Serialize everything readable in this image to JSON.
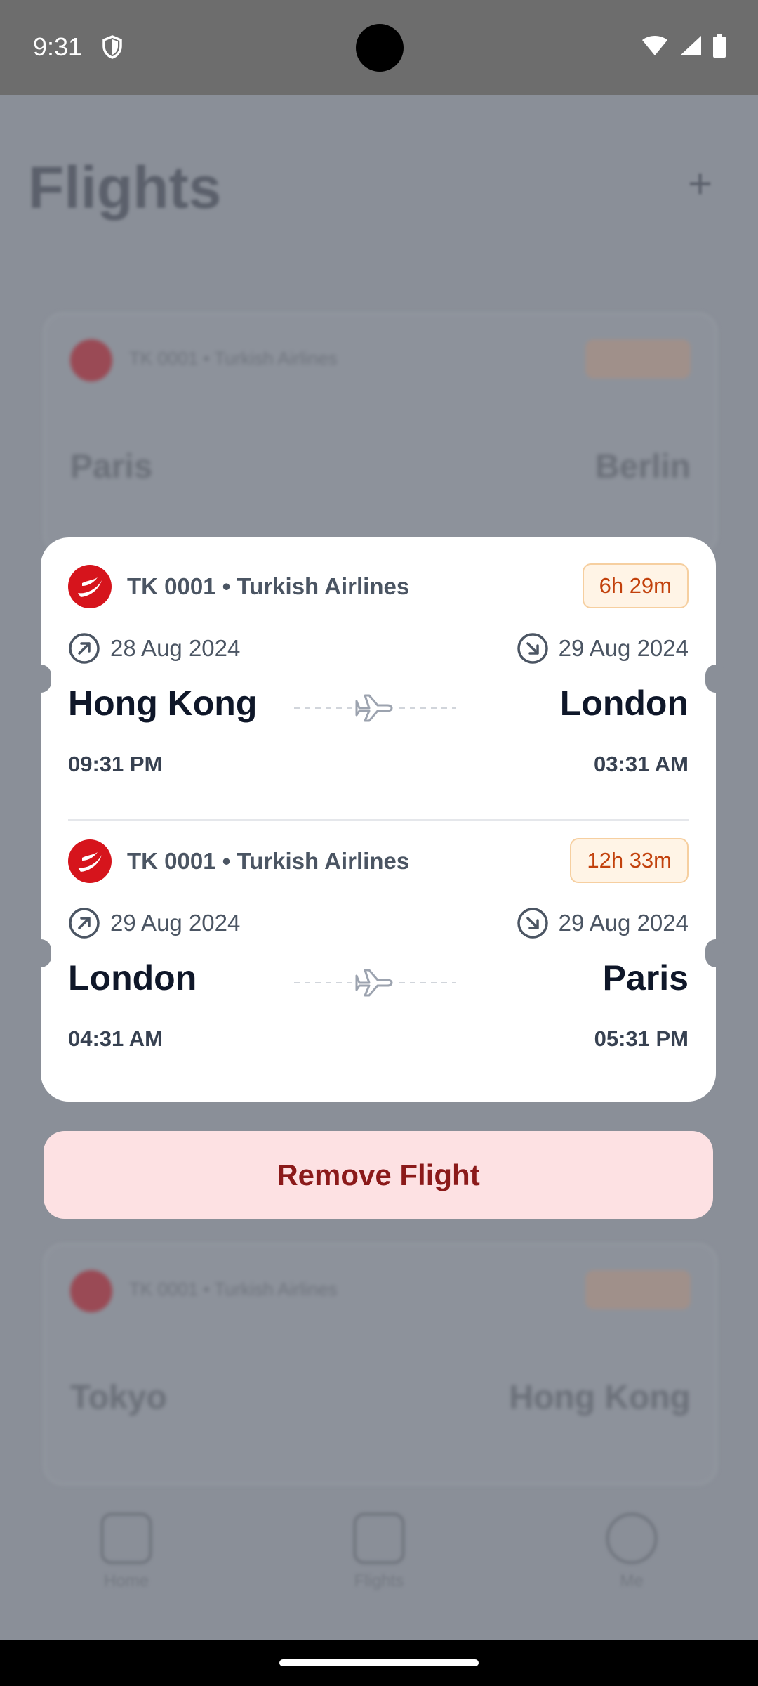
{
  "status_bar": {
    "time": "9:31",
    "icons": [
      "shield-icon",
      "wifi-icon",
      "signal-icon",
      "battery-icon"
    ]
  },
  "background": {
    "title": "Flights",
    "add_icon": "plus-icon",
    "cards": [
      {
        "airline": "TK 0001 • Turkish Airlines",
        "from": "Paris",
        "to": "Berlin"
      },
      {
        "airline": "TK 0001 • Turkish Airlines",
        "from": "Tokyo",
        "to": "Hong Kong"
      }
    ],
    "tabs": [
      "Home",
      "Flights",
      "Me"
    ]
  },
  "modal": {
    "segments": [
      {
        "airline": "TK 0001 • Turkish Airlines",
        "duration": "6h 29m",
        "departure_date": "28 Aug 2024",
        "arrival_date": "29 Aug 2024",
        "from": "Hong Kong",
        "to": "London",
        "departure_time": "09:31 PM",
        "arrival_time": "03:31 AM"
      },
      {
        "airline": "TK 0001 • Turkish Airlines",
        "duration": "12h 33m",
        "departure_date": "29 Aug 2024",
        "arrival_date": "29 Aug 2024",
        "from": "London",
        "to": "Paris",
        "departure_time": "04:31 AM",
        "arrival_time": "05:31 PM"
      }
    ]
  },
  "actions": {
    "remove_label": "Remove Flight"
  },
  "colors": {
    "accent_red": "#d6141c",
    "duration_text": "#c2410c",
    "remove_bg": "#fde1e3",
    "remove_text": "#8b1a1a"
  }
}
